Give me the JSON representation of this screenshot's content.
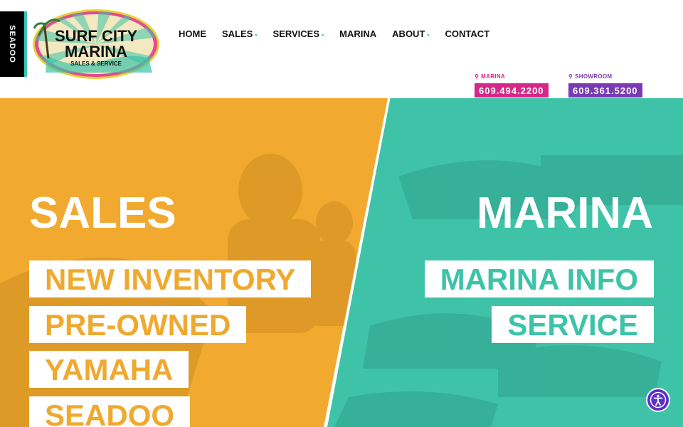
{
  "brand": {
    "seadoo_tab": "SEADOO",
    "logo_line1": "SURF CITY",
    "logo_line2": "MARINA",
    "logo_line3": "SALES & SERVICE"
  },
  "nav": {
    "items": [
      {
        "label": "HOME",
        "dropdown": false
      },
      {
        "label": "SALES",
        "dropdown": true
      },
      {
        "label": "SERVICES",
        "dropdown": true
      },
      {
        "label": "MARINA",
        "dropdown": false
      },
      {
        "label": "ABOUT",
        "dropdown": true
      },
      {
        "label": "CONTACT",
        "dropdown": false
      }
    ]
  },
  "phones": {
    "marina": {
      "label": "MARINA",
      "number": "609.494.2200",
      "color": "#d6278a"
    },
    "showroom": {
      "label": "SHOWROOM",
      "number": "609.361.5200",
      "color": "#7a3ab3"
    }
  },
  "sales": {
    "title": "SALES",
    "links": [
      "NEW INVENTORY",
      "PRE-OWNED",
      "YAMAHA",
      "SEADOO"
    ],
    "color": "#f0a92f"
  },
  "marina": {
    "title": "MARINA",
    "links": [
      "MARINA INFO",
      "SERVICE"
    ],
    "color": "#3cc3a8"
  },
  "accessibility": {
    "icon": "accessibility-icon",
    "color": "#5b30c9"
  }
}
